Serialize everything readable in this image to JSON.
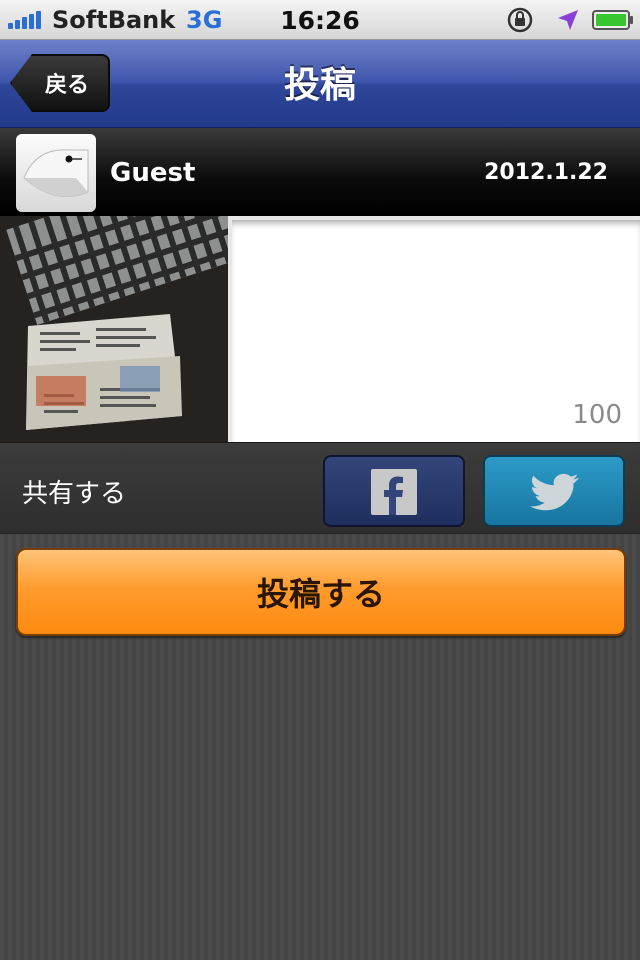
{
  "status_bar": {
    "carrier": "SoftBank",
    "network": "3G",
    "time": "16:26",
    "icons": [
      "signal-icon",
      "rotation-lock-icon",
      "location-icon",
      "battery-icon"
    ]
  },
  "nav": {
    "back_label": "戻る",
    "title": "投稿"
  },
  "user": {
    "name": "Guest",
    "date": "2012.1.22"
  },
  "post": {
    "char_count": "100"
  },
  "share": {
    "label": "共有する",
    "facebook_icon": "facebook-icon",
    "twitter_icon": "twitter-icon"
  },
  "submit": {
    "label": "投稿する"
  },
  "colors": {
    "nav_blue": "#2f4699",
    "submit_orange": "#ff9c2e",
    "facebook": "#1f2f5e",
    "twitter": "#2d9bc9"
  }
}
